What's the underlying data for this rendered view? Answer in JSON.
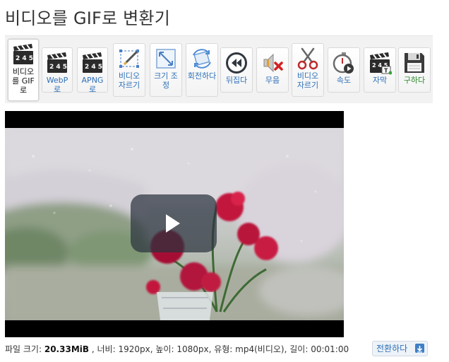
{
  "title": "비디오를 GIF로 변환기",
  "toolbar": {
    "items": [
      {
        "label": "비디오를 GIF로",
        "icon": "clapperboard-icon"
      },
      {
        "label": "WebP로",
        "icon": "clapperboard-icon"
      },
      {
        "label": "APNG로",
        "icon": "clapperboard-icon"
      },
      {
        "label": "비디오 자르기",
        "icon": "crop-icon"
      },
      {
        "label": "크기 조정",
        "icon": "resize-icon"
      },
      {
        "label": "회전하다",
        "icon": "rotate-icon"
      },
      {
        "label": "뒤집다",
        "icon": "rewind-icon"
      },
      {
        "label": "무음",
        "icon": "mute-icon"
      },
      {
        "label": "비디오 자르기",
        "icon": "scissors-icon"
      },
      {
        "label": "속도",
        "icon": "stopwatch-icon"
      },
      {
        "label": "자막",
        "icon": "subtitle-icon"
      },
      {
        "label": "구하다",
        "icon": "save-icon"
      }
    ]
  },
  "info": {
    "size_label": "파일 크기:",
    "size_value": "20.33MiB",
    "width_label": ", 너비:",
    "width_value": "1920px,",
    "height_label": "높이:",
    "height_value": "1080px,",
    "type_label": "유형:",
    "type_value": "mp4(비디오),",
    "length_label": "길이:",
    "length_value": "00:01:00"
  },
  "convert_button": {
    "label": "전환하다"
  },
  "colors": {
    "accent": "#2e6fb7",
    "save_green": "#2a8a2a",
    "toolbar_bg": "#f2f2f2"
  }
}
